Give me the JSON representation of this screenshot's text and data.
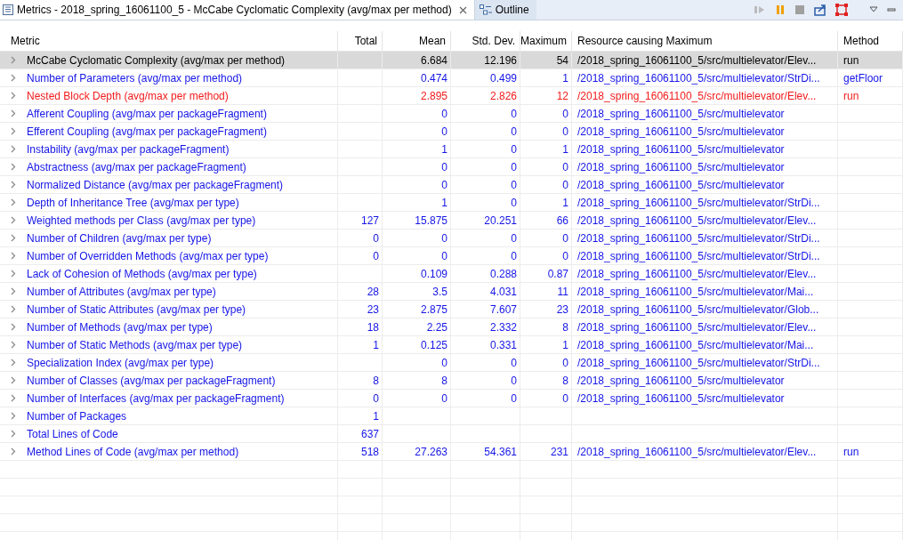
{
  "tabs": [
    {
      "label": "Metrics - 2018_spring_16061100_5 - McCabe Cyclomatic Complexity (avg/max per method)",
      "selected": true,
      "closable": true
    },
    {
      "label": "Outline",
      "selected": false,
      "closable": false
    }
  ],
  "table": {
    "columns": [
      "Metric",
      "Total",
      "Mean",
      "Std. Dev.",
      "Maximum",
      "Resource causing Maximum",
      "Method"
    ],
    "rows": [
      {
        "cells": [
          "McCabe Cyclomatic Complexity (avg/max per method)",
          "",
          "6.684",
          "12.196",
          "54",
          "/2018_spring_16061100_5/src/multielevator/Elev...",
          "run"
        ],
        "selected": true,
        "color": "#000000"
      },
      {
        "cells": [
          "Number of Parameters (avg/max per method)",
          "",
          "0.474",
          "0.499",
          "1",
          "/2018_spring_16061100_5/src/multielevator/StrDi...",
          "getFloor"
        ],
        "selected": false,
        "color": "#1515e8"
      },
      {
        "cells": [
          "Nested Block Depth (avg/max per method)",
          "",
          "2.895",
          "2.826",
          "12",
          "/2018_spring_16061100_5/src/multielevator/Elev...",
          "run"
        ],
        "selected": false,
        "color": "#f21b1b"
      },
      {
        "cells": [
          "Afferent Coupling (avg/max per packageFragment)",
          "",
          "0",
          "0",
          "0",
          "/2018_spring_16061100_5/src/multielevator",
          ""
        ],
        "selected": false,
        "color": "#1515e8"
      },
      {
        "cells": [
          "Efferent Coupling (avg/max per packageFragment)",
          "",
          "0",
          "0",
          "0",
          "/2018_spring_16061100_5/src/multielevator",
          ""
        ],
        "selected": false,
        "color": "#1515e8"
      },
      {
        "cells": [
          "Instability (avg/max per packageFragment)",
          "",
          "1",
          "0",
          "1",
          "/2018_spring_16061100_5/src/multielevator",
          ""
        ],
        "selected": false,
        "color": "#1515e8"
      },
      {
        "cells": [
          "Abstractness (avg/max per packageFragment)",
          "",
          "0",
          "0",
          "0",
          "/2018_spring_16061100_5/src/multielevator",
          ""
        ],
        "selected": false,
        "color": "#1515e8"
      },
      {
        "cells": [
          "Normalized Distance (avg/max per packageFragment)",
          "",
          "0",
          "0",
          "0",
          "/2018_spring_16061100_5/src/multielevator",
          ""
        ],
        "selected": false,
        "color": "#1515e8"
      },
      {
        "cells": [
          "Depth of Inheritance Tree (avg/max per type)",
          "",
          "1",
          "0",
          "1",
          "/2018_spring_16061100_5/src/multielevator/StrDi...",
          ""
        ],
        "selected": false,
        "color": "#1515e8"
      },
      {
        "cells": [
          "Weighted methods per Class (avg/max per type)",
          "127",
          "15.875",
          "20.251",
          "66",
          "/2018_spring_16061100_5/src/multielevator/Elev...",
          ""
        ],
        "selected": false,
        "color": "#1515e8"
      },
      {
        "cells": [
          "Number of Children (avg/max per type)",
          "0",
          "0",
          "0",
          "0",
          "/2018_spring_16061100_5/src/multielevator/StrDi...",
          ""
        ],
        "selected": false,
        "color": "#1515e8"
      },
      {
        "cells": [
          "Number of Overridden Methods (avg/max per type)",
          "0",
          "0",
          "0",
          "0",
          "/2018_spring_16061100_5/src/multielevator/StrDi...",
          ""
        ],
        "selected": false,
        "color": "#1515e8"
      },
      {
        "cells": [
          "Lack of Cohesion of Methods (avg/max per type)",
          "",
          "0.109",
          "0.288",
          "0.87",
          "/2018_spring_16061100_5/src/multielevator/Elev...",
          ""
        ],
        "selected": false,
        "color": "#1515e8"
      },
      {
        "cells": [
          "Number of Attributes (avg/max per type)",
          "28",
          "3.5",
          "4.031",
          "11",
          "/2018_spring_16061100_5/src/multielevator/Mai...",
          ""
        ],
        "selected": false,
        "color": "#1515e8"
      },
      {
        "cells": [
          "Number of Static Attributes (avg/max per type)",
          "23",
          "2.875",
          "7.607",
          "23",
          "/2018_spring_16061100_5/src/multielevator/Glob...",
          ""
        ],
        "selected": false,
        "color": "#1515e8"
      },
      {
        "cells": [
          "Number of Methods (avg/max per type)",
          "18",
          "2.25",
          "2.332",
          "8",
          "/2018_spring_16061100_5/src/multielevator/Elev...",
          ""
        ],
        "selected": false,
        "color": "#1515e8"
      },
      {
        "cells": [
          "Number of Static Methods (avg/max per type)",
          "1",
          "0.125",
          "0.331",
          "1",
          "/2018_spring_16061100_5/src/multielevator/Mai...",
          ""
        ],
        "selected": false,
        "color": "#1515e8"
      },
      {
        "cells": [
          "Specialization Index (avg/max per type)",
          "",
          "0",
          "0",
          "0",
          "/2018_spring_16061100_5/src/multielevator/StrDi...",
          ""
        ],
        "selected": false,
        "color": "#1515e8"
      },
      {
        "cells": [
          "Number of Classes (avg/max per packageFragment)",
          "8",
          "8",
          "0",
          "8",
          "/2018_spring_16061100_5/src/multielevator",
          ""
        ],
        "selected": false,
        "color": "#1515e8"
      },
      {
        "cells": [
          "Number of Interfaces (avg/max per packageFragment)",
          "0",
          "0",
          "0",
          "0",
          "/2018_spring_16061100_5/src/multielevator",
          ""
        ],
        "selected": false,
        "color": "#1515e8"
      },
      {
        "cells": [
          "Number of Packages",
          "1",
          "",
          "",
          "",
          "",
          ""
        ],
        "selected": false,
        "color": "#1515e8"
      },
      {
        "cells": [
          "Total Lines of Code",
          "637",
          "",
          "",
          "",
          "",
          ""
        ],
        "selected": false,
        "color": "#1515e8"
      },
      {
        "cells": [
          "Method Lines of Code (avg/max per method)",
          "518",
          "27.263",
          "54.361",
          "231",
          "/2018_spring_16061100_5/src/multielevator/Elev...",
          "run"
        ],
        "selected": false,
        "color": "#1515e8"
      }
    ]
  }
}
